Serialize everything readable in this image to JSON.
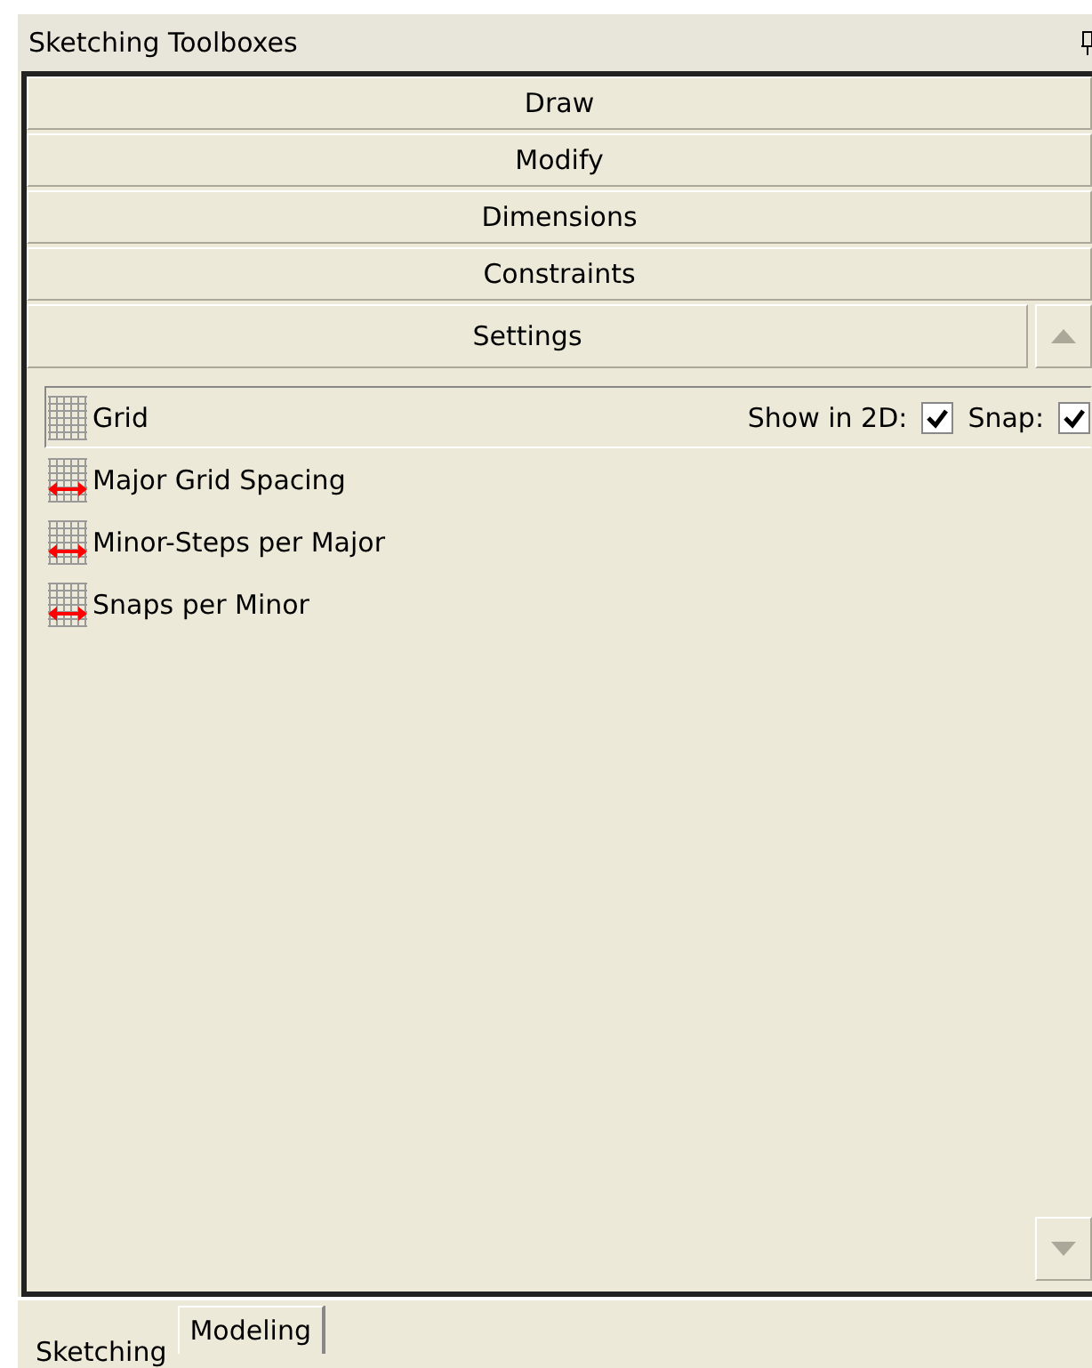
{
  "window": {
    "title": "Sketching Toolboxes"
  },
  "sections": [
    {
      "label": "Draw",
      "expanded": false
    },
    {
      "label": "Modify",
      "expanded": false
    },
    {
      "label": "Dimensions",
      "expanded": false
    },
    {
      "label": "Constraints",
      "expanded": false
    },
    {
      "label": "Settings",
      "expanded": true
    }
  ],
  "settings": [
    {
      "kind": "toggle",
      "label": "Grid",
      "selected": true,
      "options": [
        {
          "label": "Show in 2D:",
          "checked": true
        },
        {
          "label": "Snap:",
          "checked": true
        }
      ]
    },
    {
      "kind": "spacing",
      "label": "Major Grid Spacing",
      "selected": false
    },
    {
      "kind": "spacing",
      "label": "Minor-Steps per Major",
      "selected": false
    },
    {
      "kind": "spacing",
      "label": "Snaps per Minor",
      "selected": false
    }
  ],
  "tabs": [
    {
      "label": "Sketching",
      "selected": true
    },
    {
      "label": "Modeling",
      "selected": false
    }
  ]
}
